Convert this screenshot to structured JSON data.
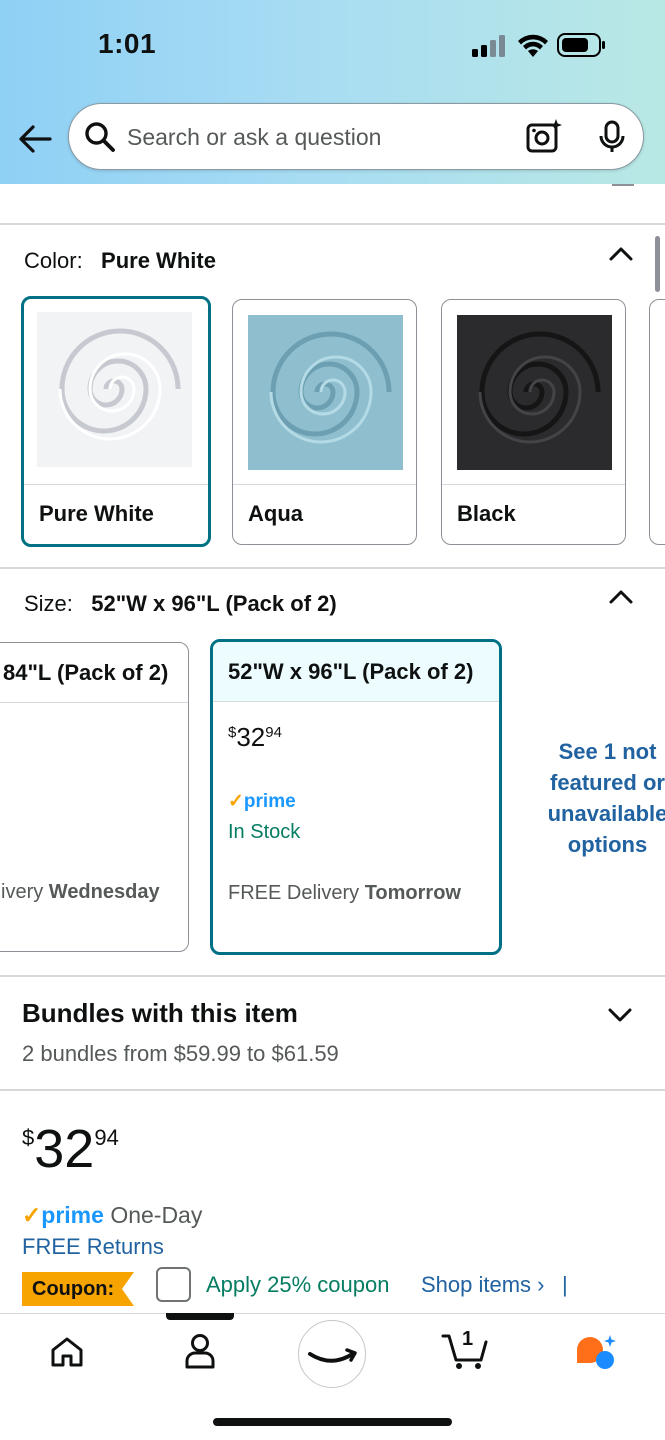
{
  "status_bar": {
    "time": "1:01"
  },
  "search": {
    "placeholder": "Search or ask a question"
  },
  "color_section": {
    "label": "Color:",
    "selected": "Pure White",
    "options": [
      {
        "name": "Pure White",
        "color": "#f2f3f5"
      },
      {
        "name": "Aqua",
        "color": "#8fbfcf"
      },
      {
        "name": "Black",
        "color": "#2b2b2d"
      }
    ]
  },
  "size_section": {
    "label": "Size:",
    "selected": "52\"W x 96\"L (Pack of 2)",
    "prev_option": {
      "label": "84\"L (Pack of 2)",
      "delivery_prefix": "ivery",
      "delivery_day": "Wednesday"
    },
    "selected_option": {
      "label": "52\"W x 96\"L (Pack of 2)",
      "price_symbol": "$",
      "price_whole": "32",
      "price_fraction": "94",
      "prime": "prime",
      "stock": "In Stock",
      "delivery_prefix": "FREE Delivery",
      "delivery_day": "Tomorrow"
    },
    "see_more": [
      "See 1 not",
      "featured or",
      "unavailable",
      "options"
    ]
  },
  "bundles": {
    "title": "Bundles with this item",
    "subtitle": "2 bundles from $59.99 to $61.59"
  },
  "buybox": {
    "price_symbol": "$",
    "price_whole": "32",
    "price_fraction": "94",
    "prime": "prime",
    "prime_suffix": "One-Day",
    "returns": "FREE Returns",
    "coupon_badge": "Coupon:",
    "coupon_text": "Apply 25% coupon",
    "shop_items": "Shop items ›",
    "separator": "|"
  },
  "bottom_nav": {
    "cart_count": "1"
  },
  "colors": {
    "accent": "#007185",
    "link": "#2162a1",
    "green": "#067d62",
    "prime": "#1a98ff",
    "coupon": "#f7a400"
  }
}
